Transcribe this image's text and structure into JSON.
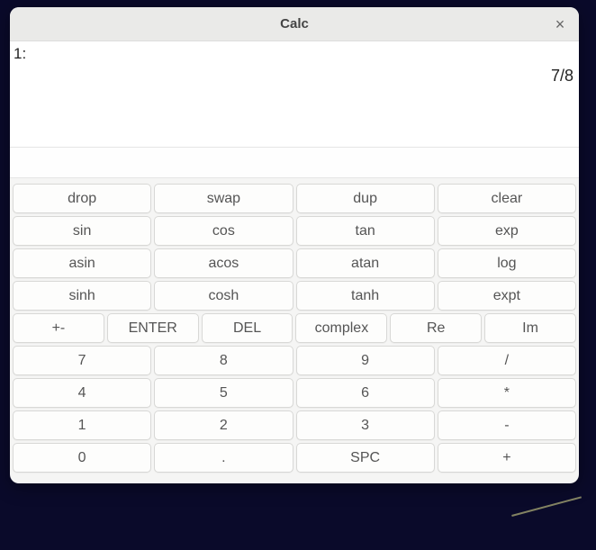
{
  "window": {
    "title": "Calc",
    "close_glyph": "×"
  },
  "display": {
    "stack_index": "1:",
    "stack_value": "7/8"
  },
  "rows": {
    "r1": [
      "drop",
      "swap",
      "dup",
      "clear"
    ],
    "r2": [
      "sin",
      "cos",
      "tan",
      "exp"
    ],
    "r3": [
      "asin",
      "acos",
      "atan",
      "log"
    ],
    "r4": [
      "sinh",
      "cosh",
      "tanh",
      "expt"
    ],
    "r5": [
      "+-",
      "ENTER",
      "DEL",
      "complex",
      "Re",
      "Im"
    ],
    "r6": [
      "7",
      "8",
      "9",
      "/"
    ],
    "r7": [
      "4",
      "5",
      "6",
      "*"
    ],
    "r8": [
      "1",
      "2",
      "3",
      "-"
    ],
    "r9": [
      "0",
      ".",
      "SPC",
      "+"
    ]
  }
}
